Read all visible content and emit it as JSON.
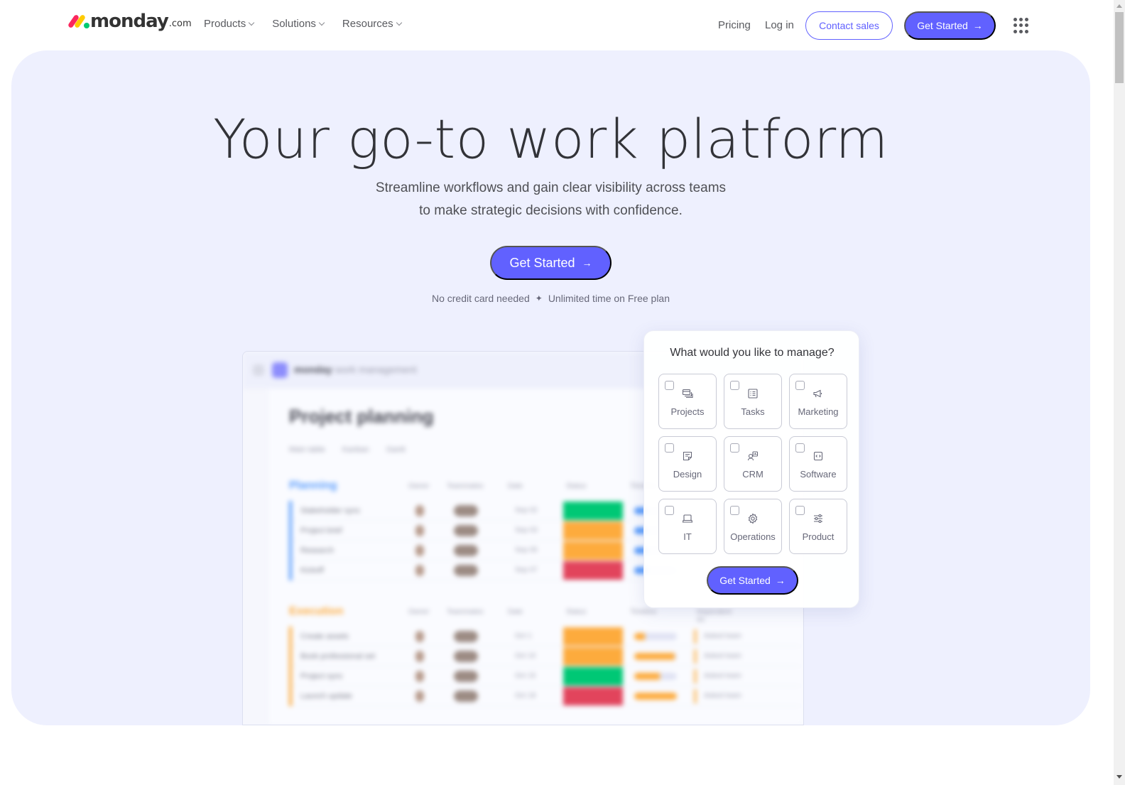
{
  "header": {
    "logo": {
      "word": "monday",
      "suffix": ".com"
    },
    "nav": [
      {
        "label": "Products"
      },
      {
        "label": "Solutions"
      },
      {
        "label": "Resources"
      }
    ],
    "pricing": "Pricing",
    "login": "Log in",
    "contact_sales": "Contact sales",
    "get_started": "Get Started",
    "arrow": "→"
  },
  "hero": {
    "title": "Your go-to work platform",
    "subtitle_line1": "Streamline workflows and gain clear visibility across teams",
    "subtitle_line2": "to make strategic decisions with confidence.",
    "cta": "Get Started",
    "arrow": "→",
    "note_left": "No credit card needed",
    "note_sep": "✦",
    "note_right": "Unlimited time on Free plan"
  },
  "board_preview": {
    "app_name_bold": "monday",
    "app_name_rest": " work management",
    "title": "Project planning",
    "tabs": [
      "Main table",
      "Kanban",
      "Gantt"
    ],
    "columns": [
      "Owner",
      "Teammates",
      "Date",
      "Status",
      "Timeline",
      "Dependent on"
    ],
    "colors": {
      "planning": "#579bfc",
      "execution": "#fdab3d",
      "done": "#00c875",
      "working": "#fdab3d",
      "stuck": "#e2445c"
    },
    "groups": [
      {
        "name": "Planning",
        "color": "#579bfc",
        "rows": [
          {
            "name": "Stakeholder sync",
            "date": "Sep 02",
            "status": "done",
            "timeline": 0.3
          },
          {
            "name": "Project brief",
            "date": "Sep 03",
            "status": "working",
            "timeline": 0.3
          },
          {
            "name": "Research",
            "date": "Sep 05",
            "status": "working",
            "timeline": 0.3
          },
          {
            "name": "Kickoff",
            "date": "Sep 07",
            "status": "stuck",
            "timeline": 0.3
          }
        ]
      },
      {
        "name": "Execution",
        "color": "#fdab3d",
        "rows": [
          {
            "name": "Create assets",
            "date": "Oct 1",
            "status": "working",
            "timeline": 0.25,
            "dep": "Asked team"
          },
          {
            "name": "Book professional set",
            "date": "Oct 10",
            "status": "working",
            "timeline": 0.95,
            "dep": "Asked team"
          },
          {
            "name": "Project sync",
            "date": "Oct 15",
            "status": "done",
            "timeline": 0.6,
            "dep": "Asked team"
          },
          {
            "name": "Launch update",
            "date": "Oct 18",
            "status": "stuck",
            "timeline": 1.0,
            "dep": "Asked team"
          }
        ]
      }
    ]
  },
  "manage_card": {
    "title": "What would you like to manage?",
    "options": [
      {
        "label": "Projects",
        "icon": "projects-icon",
        "checked": false
      },
      {
        "label": "Tasks",
        "icon": "tasks-icon",
        "checked": false
      },
      {
        "label": "Marketing",
        "icon": "megaphone-icon",
        "checked": false
      },
      {
        "label": "Design",
        "icon": "design-icon",
        "checked": false
      },
      {
        "label": "CRM",
        "icon": "crm-icon",
        "checked": false
      },
      {
        "label": "Software",
        "icon": "code-icon",
        "checked": false
      },
      {
        "label": "IT",
        "icon": "laptop-icon",
        "checked": false
      },
      {
        "label": "Operations",
        "icon": "gear-icon",
        "checked": false
      },
      {
        "label": "Product",
        "icon": "sliders-icon",
        "checked": false
      }
    ],
    "cta": "Get Started",
    "arrow": "→"
  },
  "colors": {
    "accent": "#6161ff",
    "hero_bg": "#eef0fe",
    "text": "#323338"
  }
}
